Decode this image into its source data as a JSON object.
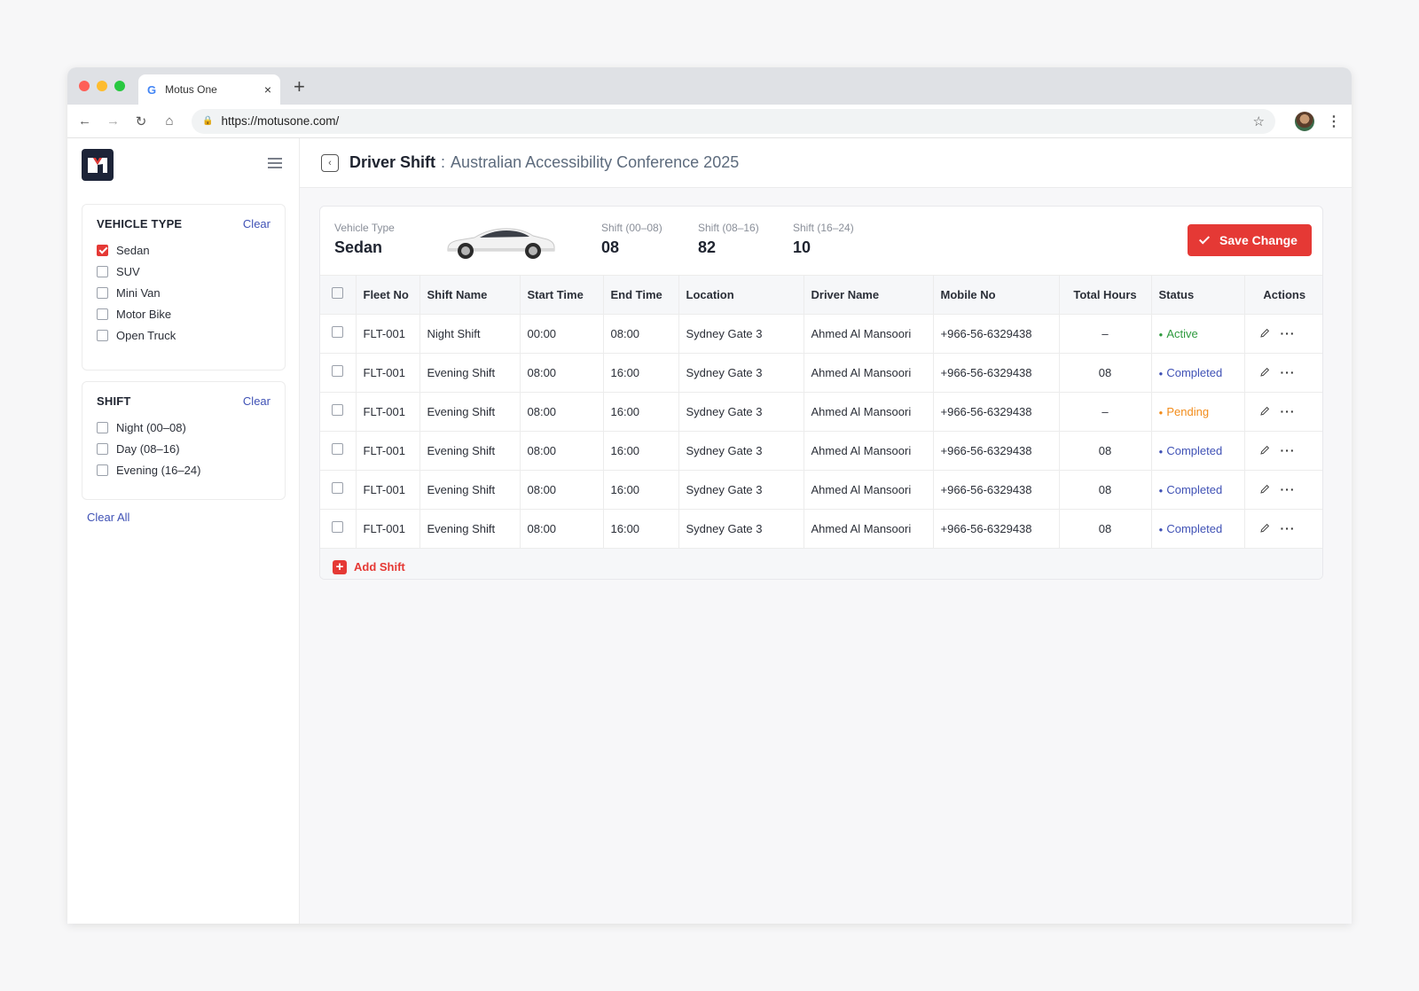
{
  "browser": {
    "tab_title": "Motus One",
    "tab_close": "×",
    "new_tab": "+",
    "url": "https://motusone.com/"
  },
  "sidebar": {
    "vehicle_type": {
      "title": "VEHICLE TYPE",
      "clear_label": "Clear",
      "options": [
        {
          "label": "Sedan",
          "checked": true
        },
        {
          "label": "SUV",
          "checked": false
        },
        {
          "label": "Mini Van",
          "checked": false
        },
        {
          "label": "Motor Bike",
          "checked": false
        },
        {
          "label": "Open Truck",
          "checked": false
        }
      ]
    },
    "shift": {
      "title": "SHIFT",
      "clear_label": "Clear",
      "options": [
        {
          "label": "Night (00–08)",
          "checked": false
        },
        {
          "label": "Day (08–16)",
          "checked": false
        },
        {
          "label": "Evening (16–24)",
          "checked": false
        }
      ]
    },
    "clear_all_label": "Clear All"
  },
  "header": {
    "title": "Driver Shift",
    "separator": ":",
    "subtitle": "Australian Accessibility Conference 2025"
  },
  "summary": {
    "vehicle_type_label": "Vehicle Type",
    "vehicle_type_value": "Sedan",
    "shifts": [
      {
        "label": "Shift (00–08)",
        "value": "08"
      },
      {
        "label": "Shift (08–16)",
        "value": "82"
      },
      {
        "label": "Shift (16–24)",
        "value": "10"
      }
    ],
    "save_label": "Save Change"
  },
  "table": {
    "columns": [
      "Fleet No",
      "Shift Name",
      "Start Time",
      "End Time",
      "Location",
      "Driver Name",
      "Mobile No",
      "Total Hours",
      "Status",
      "Actions"
    ],
    "rows": [
      {
        "fleet": "FLT-001",
        "shift": "Night Shift",
        "start": "00:00",
        "end": "08:00",
        "location": "Sydney Gate 3",
        "driver": "Ahmed Al Mansoori",
        "mobile": "+966-56-6329438",
        "hours": "–",
        "status": "Active"
      },
      {
        "fleet": "FLT-001",
        "shift": "Evening Shift",
        "start": "08:00",
        "end": "16:00",
        "location": "Sydney Gate 3",
        "driver": "Ahmed Al Mansoori",
        "mobile": "+966-56-6329438",
        "hours": "08",
        "status": "Completed"
      },
      {
        "fleet": "FLT-001",
        "shift": "Evening Shift",
        "start": "08:00",
        "end": "16:00",
        "location": "Sydney Gate 3",
        "driver": "Ahmed Al Mansoori",
        "mobile": "+966-56-6329438",
        "hours": "–",
        "status": "Pending"
      },
      {
        "fleet": "FLT-001",
        "shift": "Evening Shift",
        "start": "08:00",
        "end": "16:00",
        "location": "Sydney Gate 3",
        "driver": "Ahmed Al Mansoori",
        "mobile": "+966-56-6329438",
        "hours": "08",
        "status": "Completed"
      },
      {
        "fleet": "FLT-001",
        "shift": "Evening Shift",
        "start": "08:00",
        "end": "16:00",
        "location": "Sydney Gate 3",
        "driver": "Ahmed Al Mansoori",
        "mobile": "+966-56-6329438",
        "hours": "08",
        "status": "Completed"
      },
      {
        "fleet": "FLT-001",
        "shift": "Evening Shift",
        "start": "08:00",
        "end": "16:00",
        "location": "Sydney Gate 3",
        "driver": "Ahmed Al Mansoori",
        "mobile": "+966-56-6329438",
        "hours": "08",
        "status": "Completed"
      }
    ],
    "add_label": "Add Shift"
  },
  "colors": {
    "accent": "#e53935",
    "link": "#3f51b5",
    "active": "#2e9a3e",
    "completed": "#3f51b5",
    "pending": "#f28c1b"
  },
  "icons": [
    "google-icon",
    "back-arrow-icon",
    "forward-arrow-icon",
    "reload-icon",
    "home-icon",
    "lock-icon",
    "star-icon",
    "profile-avatar",
    "kebab-menu-icon",
    "app-logo",
    "hamburger-menu-icon",
    "chevron-left-icon",
    "car-image",
    "check-icon",
    "pencil-icon",
    "more-icon",
    "plus-icon"
  ]
}
